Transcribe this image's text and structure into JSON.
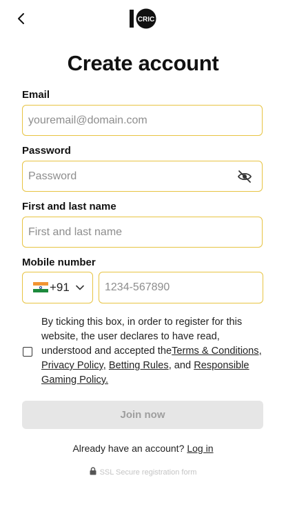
{
  "header": {
    "back_icon": "chevron-left-icon",
    "logo_text": "CRIC",
    "logo_digits": "10"
  },
  "title": "Create account",
  "form": {
    "email": {
      "label": "Email",
      "placeholder": "youremail@domain.com",
      "value": ""
    },
    "password": {
      "label": "Password",
      "placeholder": "Password",
      "value": "",
      "toggle_icon": "eye-off-icon"
    },
    "name": {
      "label": "First and last name",
      "placeholder": "First and last name",
      "value": ""
    },
    "mobile": {
      "label": "Mobile number",
      "country_code": "+91",
      "flag_icon": "india-flag-icon",
      "placeholder": "1234-567890",
      "value": ""
    }
  },
  "consent": {
    "text": "By ticking this box, in order to register for this website, the user declares to have read, understood and accepted the",
    "links": [
      "Terms & Conditions,",
      "Privacy Policy,",
      "Betting Rules"
    ],
    "and": ", and",
    "last_link": "Responsible Gaming Policy.",
    "checked": false
  },
  "join_button": "Join now",
  "login": {
    "prompt": "Already have an account?",
    "link": "Log in"
  },
  "secure_note": "SSL Secure registration form",
  "colors": {
    "field_border": "#e7c341",
    "button_disabled_bg": "#e6e6e6",
    "button_disabled_text": "#9e9e9e"
  }
}
